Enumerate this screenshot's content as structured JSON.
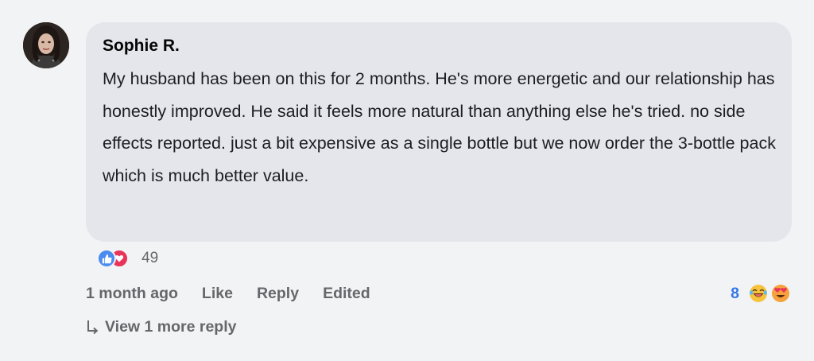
{
  "comment": {
    "author": "Sophie R.",
    "text": "My husband has been on this for 2 months. He's more energetic and our relationship has honestly improved. He said it feels more natural than anything else he's tried. no side effects reported. just a bit expensive as a single bottle but we now order the 3-bottle pack which is much better value.",
    "reactions": {
      "types": [
        "like-icon",
        "love-icon"
      ],
      "count": "49"
    },
    "actions": {
      "timestamp": "1 month ago",
      "like_label": "Like",
      "reply_label": "Reply",
      "edited_label": "Edited"
    },
    "reply_reactions": {
      "count": "8",
      "types": [
        "laugh-emoji-icon",
        "heart-eyes-emoji-icon"
      ]
    },
    "more_replies_label": "View 1 more reply"
  },
  "colors": {
    "background": "#f2f3f5",
    "bubble": "#e4e6eb",
    "secondary_text": "#65676b",
    "count_blue": "#3578e5",
    "like_blue": "#4a8cf0",
    "love_red": "#e8335a"
  }
}
